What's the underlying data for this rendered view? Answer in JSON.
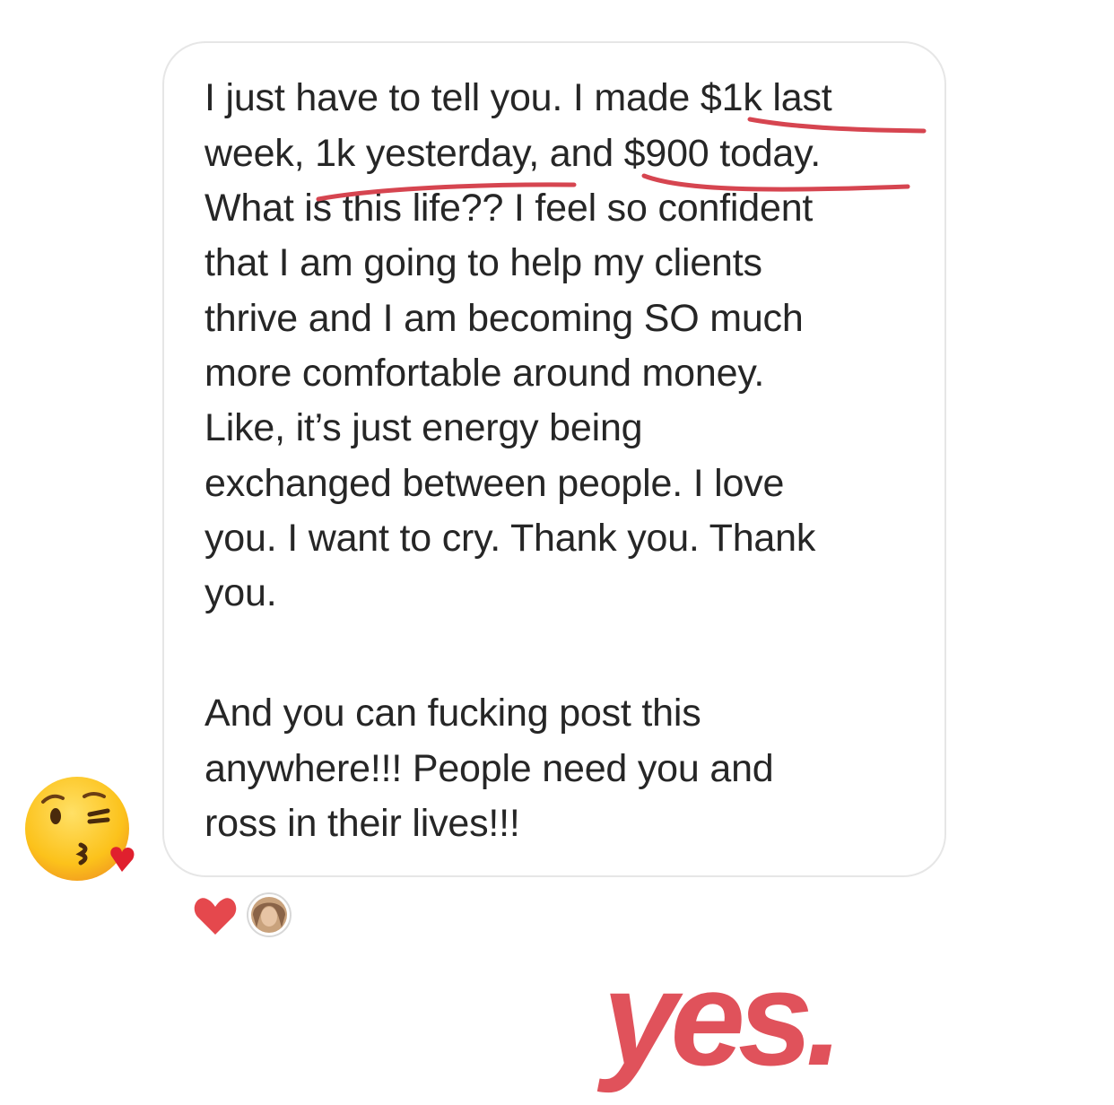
{
  "message": {
    "lines": [
      "I just have to tell you. I made $1k last",
      "week, 1k yesterday, and $900 today.",
      "What is this life?? I feel so confident",
      "that I am going to help my clients",
      "thrive and I am becoming SO much",
      "more comfortable around money.",
      "Like, it’s just energy being",
      "exchanged between people. I love",
      "you. I want to cry. Thank you. Thank",
      "you.",
      "And you can fucking post this",
      "anywhere!!! People need you and",
      "ross in their lives!!!"
    ]
  },
  "sender": {
    "emoji_icon": "face-blowing-kiss-icon"
  },
  "reactions": {
    "heart_icon": "heart-icon",
    "avatar_icon": "avatar"
  },
  "overlay": {
    "caption": "yes."
  },
  "colors": {
    "text": "#262626",
    "bubble_border": "#e6e6e6",
    "underline": "#d64550",
    "heart": "#e5484d",
    "caption": "#e0525b"
  }
}
